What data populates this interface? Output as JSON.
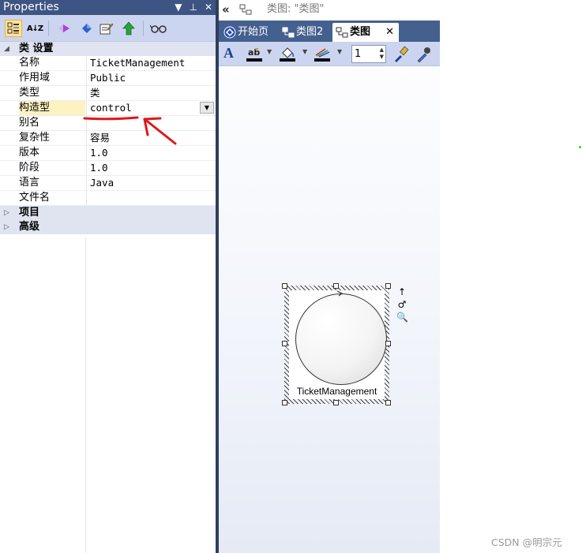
{
  "properties_panel": {
    "title": "Properties",
    "title_buttons": [
      "▼",
      "⊥",
      "✕"
    ],
    "toolbar_icons": [
      "categorized-icon",
      "sort-az-icon",
      "element-icon",
      "gem-icon",
      "edit-icon",
      "up-arrow-icon",
      "glasses-icon"
    ],
    "sort_label": "A↓Z",
    "category_settings": "类 设置",
    "rows": [
      {
        "name": "名称",
        "value": "TicketManagement"
      },
      {
        "name": "作用域",
        "value": "Public"
      },
      {
        "name": "类型",
        "value": "类"
      },
      {
        "name": "构造型",
        "value": "control"
      },
      {
        "name": "别名",
        "value": ""
      },
      {
        "name": "复杂性",
        "value": "容易"
      },
      {
        "name": "版本",
        "value": "1.0"
      },
      {
        "name": "阶段",
        "value": "1.0"
      },
      {
        "name": "语言",
        "value": "Java"
      },
      {
        "name": "文件名",
        "value": ""
      }
    ],
    "category_project": "项目",
    "category_advanced": "高级"
  },
  "diagram_panel": {
    "header_back": "«",
    "header_title": "类图: \"类图\"",
    "tabs": [
      {
        "label": "开始页"
      },
      {
        "label": "类图2"
      },
      {
        "label": "类图"
      }
    ],
    "close_glyph": "✕",
    "font_button": "A",
    "line_width_value": "1",
    "colors": {
      "font": "#000000",
      "fill": "#000000",
      "line": "#000000",
      "tab_bar": "#44608f",
      "toolbar": "#ccd5f0"
    }
  },
  "class_element": {
    "name": "TicketManagement",
    "stereotype_shape": "control-circle"
  },
  "side_tools": [
    "↑",
    "♂",
    "🔍"
  ],
  "watermark": "CSDN @明宗元"
}
